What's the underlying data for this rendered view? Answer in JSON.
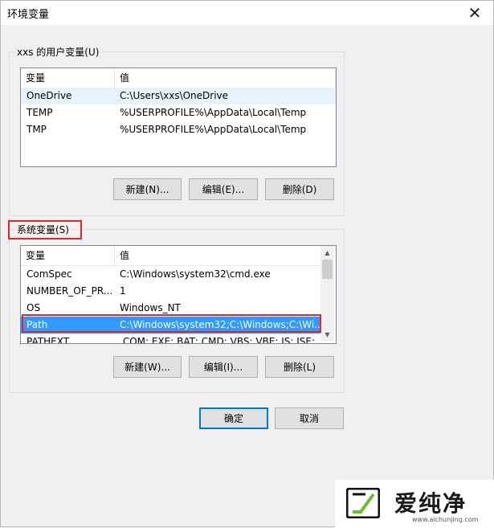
{
  "window": {
    "title": "环境变量",
    "close_glyph": "✕"
  },
  "user_vars": {
    "group_label": "xxs 的用户变量(U)",
    "col_var": "变量",
    "col_val": "值",
    "rows": [
      {
        "var": "OneDrive",
        "val": "C:\\Users\\xxs\\OneDrive"
      },
      {
        "var": "TEMP",
        "val": "%USERPROFILE%\\AppData\\Local\\Temp"
      },
      {
        "var": "TMP",
        "val": "%USERPROFILE%\\AppData\\Local\\Temp"
      }
    ],
    "buttons": {
      "new": "新建(N)...",
      "edit": "编辑(E)...",
      "delete": "删除(D)"
    }
  },
  "system_vars": {
    "group_label": "系统变量(S)",
    "col_var": "变量",
    "col_val": "值",
    "rows": [
      {
        "var": "ComSpec",
        "val": "C:\\Windows\\system32\\cmd.exe"
      },
      {
        "var": "NUMBER_OF_PR...",
        "val": "1"
      },
      {
        "var": "OS",
        "val": "Windows_NT"
      },
      {
        "var": "Path",
        "val": "C:\\Windows\\system32;C:\\Windows;C:\\Wi..."
      },
      {
        "var": "PATHEXT",
        "val": ".COM;.EXE;.BAT;.CMD;.VBS;.VBE;.JS;.JSE;..."
      }
    ],
    "buttons": {
      "new": "新建(W)...",
      "edit": "编辑(I)...",
      "delete": "删除(L)"
    }
  },
  "footer": {
    "ok": "确定",
    "cancel": "取消"
  },
  "watermark": {
    "brand": "爱纯净",
    "url": "www.aichunjing.com"
  },
  "colors": {
    "selected": "#3399ff",
    "highlight_box": "#e0262b",
    "default_button_border": "#0078d7"
  }
}
